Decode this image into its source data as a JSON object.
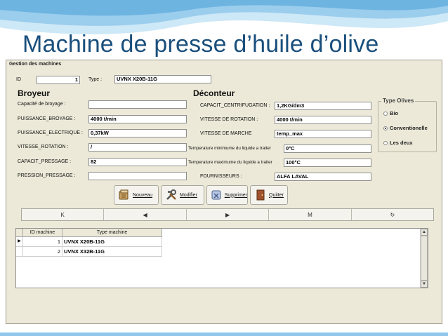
{
  "slide": {
    "title": "Machine de presse d’huile d’olive"
  },
  "window": {
    "title": "Gestion des machines"
  },
  "top": {
    "id_label": "ID",
    "id_value": "1",
    "type_label": "Type :",
    "type_value": "UVNX X20B-11G"
  },
  "broyeur": {
    "header": "Broyeur",
    "fields": [
      {
        "label": "Capacité de broyage :",
        "value": ""
      },
      {
        "label": "PUISSANCE_BROYAGE :",
        "value": "4000 t/min"
      },
      {
        "label": "PUISSANCE_ELECTRIQUE :",
        "value": "0,37kW"
      },
      {
        "label": "VITESSE_ROTATION :",
        "value": "/"
      },
      {
        "label": "CAPACIT_PRESSAGE :",
        "value": "82"
      },
      {
        "label": "PRESSION_PRESSAGE :",
        "value": ""
      }
    ]
  },
  "deconteur": {
    "header": "Déconteur",
    "fields": [
      {
        "label": "CAPACIT_CENTRIFUGATION :",
        "value": "1,2KG/dm3"
      },
      {
        "label": "VITESSE DE ROTATION :",
        "value": "4000 t/min"
      },
      {
        "label": "VITESSE DE MARCHE",
        "value": "temp_max"
      },
      {
        "label": "Temperature minimume du liquide a traiter",
        "value": "0°C"
      },
      {
        "label": "Temperature maximume du liquide a traiter",
        "value": "100°C"
      },
      {
        "label": "FOURNISSEURS :",
        "value": "ALFA LAVAL"
      }
    ]
  },
  "type_olives": {
    "title": "Type Olives",
    "options": [
      "Bio",
      "Conventionelle",
      "Les deux"
    ],
    "selected": "Conventionelle"
  },
  "buttons": {
    "nouveau": "Nouveau",
    "modifier": "Modifier",
    "supprimer": "Supprimer",
    "quitter": "Quitter"
  },
  "nav": {
    "first": "K",
    "prev": "◀",
    "next": "▶",
    "last": "M",
    "refresh": "↻"
  },
  "grid": {
    "columns": [
      "ID machine",
      "Type machine"
    ],
    "rows": [
      {
        "id": "1",
        "type": "UVNX X20B-11G"
      },
      {
        "id": "2",
        "type": "UVNX X32B-11G"
      }
    ]
  },
  "colors": {
    "title": "#1a4f7c",
    "window_bg": "#ece9d8",
    "wave": "#8fc6ea"
  }
}
